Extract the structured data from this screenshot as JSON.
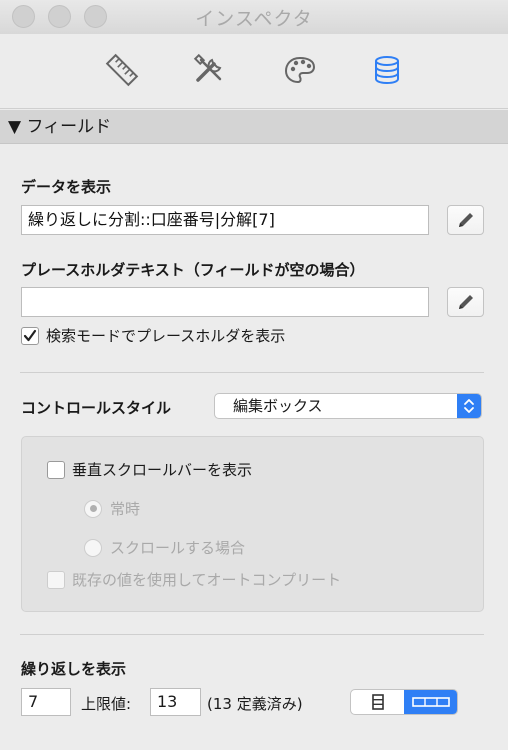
{
  "window": {
    "title": "インスペクタ"
  },
  "toolbar": {
    "tabs": [
      {
        "icon": "ruler-icon"
      },
      {
        "icon": "tools-icon"
      },
      {
        "icon": "palette-icon"
      },
      {
        "icon": "database-icon",
        "selected": true
      }
    ],
    "accent_color": "#2f7ff5"
  },
  "section": {
    "label": "▼ フィールド"
  },
  "display_data": {
    "label": "データを表示",
    "value": "繰り返しに分割::口座番号|分解[7]"
  },
  "placeholder": {
    "label": "プレースホルダテキスト（フィールドが空の場合）",
    "value": "",
    "show_in_find_label": "検索モードでプレースホルダを表示",
    "show_in_find_checked": true
  },
  "control_style": {
    "label": "コントロールスタイル",
    "selected": "編集ボックス"
  },
  "edit_box_options": {
    "vertical_scrollbar_label": "垂直スクロールバーを表示",
    "vertical_scrollbar_checked": false,
    "radio_always": "常時",
    "radio_when_scrolling": "スクロールする場合",
    "autocomplete_label": "既存の値を使用してオートコンプリート",
    "autocomplete_checked": false
  },
  "repetitions": {
    "label": "繰り返しを表示",
    "from_value": "7",
    "upper_limit_label": "上限値:",
    "upper_limit_value": "13",
    "defined_note": "(13 定義済み)",
    "orientation": "horizontal"
  }
}
